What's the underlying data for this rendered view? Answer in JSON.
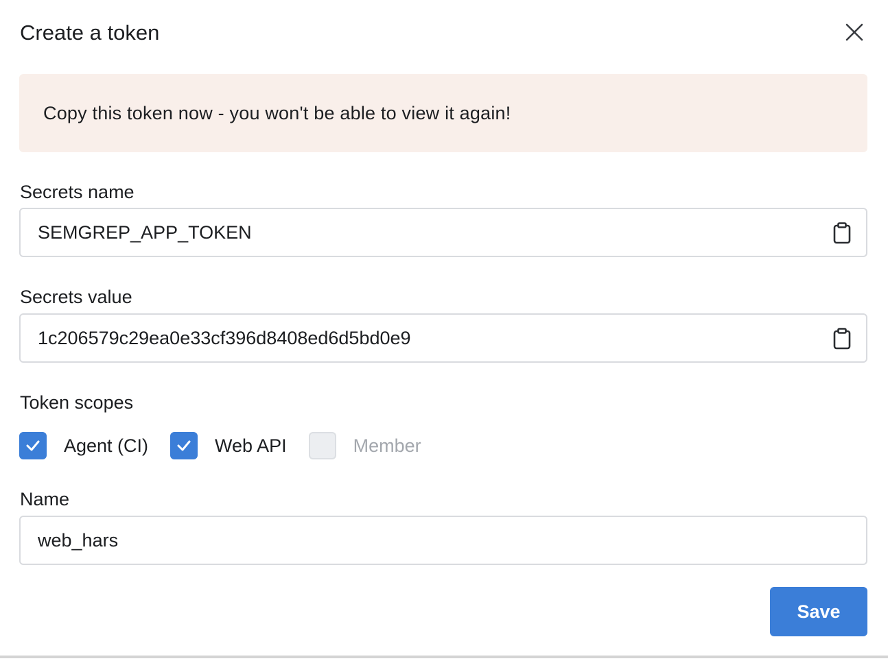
{
  "dialog": {
    "title": "Create a token",
    "close_icon": "close-icon"
  },
  "banner": {
    "text": "Copy this token now - you won't be able to view it again!"
  },
  "secrets_name": {
    "label": "Secrets name",
    "value": "SEMGREP_APP_TOKEN",
    "copy_icon": "clipboard-icon"
  },
  "secrets_value": {
    "label": "Secrets value",
    "value": "1c206579c29ea0e33cf396d8408ed6d5bd0e9",
    "copy_icon": "clipboard-icon"
  },
  "token_scopes": {
    "label": "Token scopes",
    "items": [
      {
        "label": "Agent (CI)",
        "checked": true,
        "disabled": false
      },
      {
        "label": "Web API",
        "checked": true,
        "disabled": false
      },
      {
        "label": "Member",
        "checked": false,
        "disabled": true
      }
    ]
  },
  "name_field": {
    "label": "Name",
    "value": "web_hars"
  },
  "actions": {
    "save_label": "Save"
  },
  "colors": {
    "primary": "#3b7ed8",
    "banner_bg": "#f9efea",
    "border": "#d9dbdf",
    "disabled_text": "#a3a7ad"
  }
}
